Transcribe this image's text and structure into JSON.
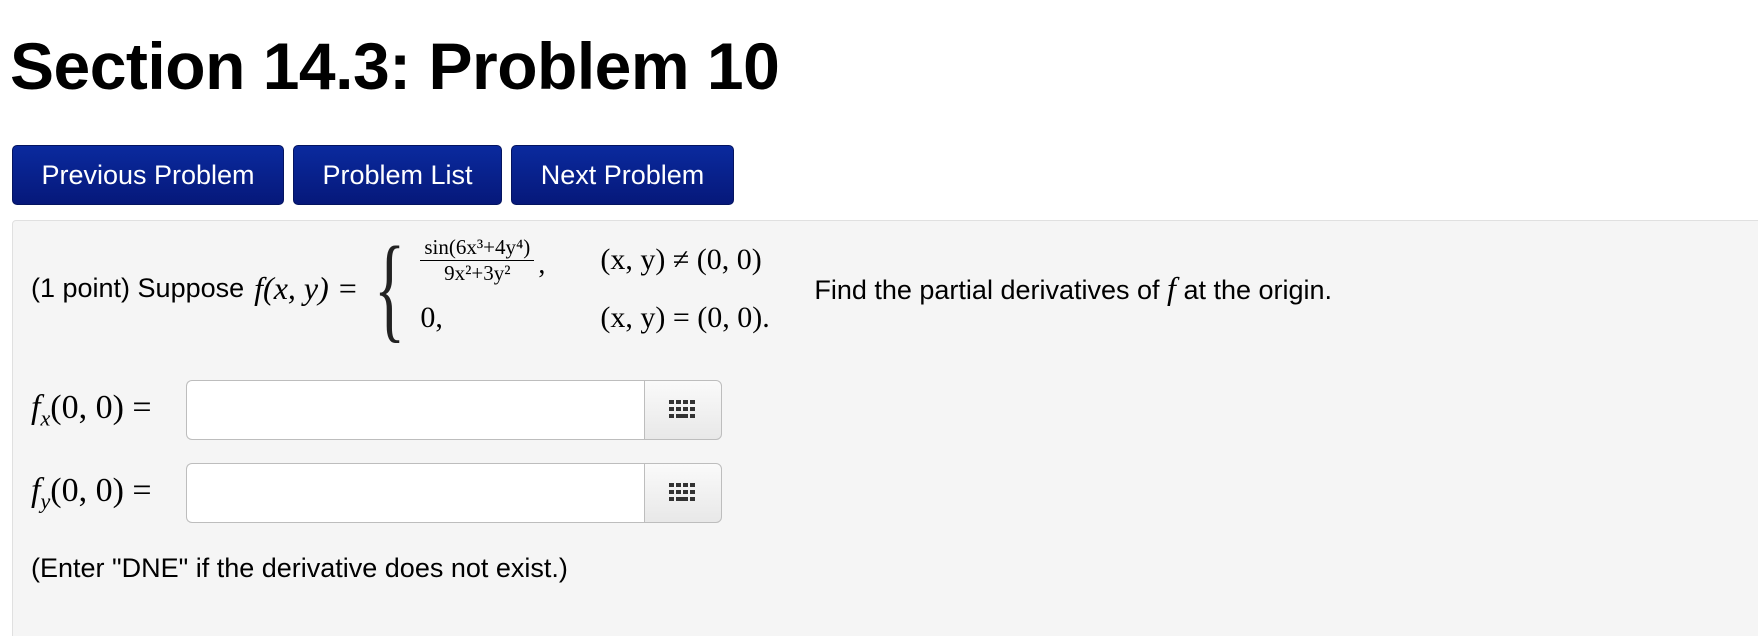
{
  "page": {
    "title": "Section 14.3: Problem 10"
  },
  "nav": {
    "previous": "Previous Problem",
    "list": "Problem List",
    "next": "Next Problem",
    "button_color": "#0a1f8f"
  },
  "problem": {
    "prefix": "(1 point) Suppose",
    "function_name": "f(x, y) =",
    "case1": {
      "numerator": "sin(6x³+4y⁴)",
      "denominator": "9x²+3y²",
      "condition": "(x, y) ≠ (0, 0)"
    },
    "case2": {
      "value": "0,",
      "condition": "(x, y) = (0, 0)."
    },
    "after_text_1": "Find the partial derivatives of",
    "after_f": "f",
    "after_text_2": "at the origin."
  },
  "answers": [
    {
      "label_main": "f",
      "label_sub": "x",
      "label_tail": "(0, 0) =",
      "value": "",
      "keypad_icon": "keypad-icon"
    },
    {
      "label_main": "f",
      "label_sub": "y",
      "label_tail": "(0, 0) =",
      "value": "",
      "keypad_icon": "keypad-icon"
    }
  ],
  "note": "(Enter \"DNE\" if the derivative does not exist.)",
  "colors": {
    "panel_bg": "#f5f5f5",
    "button_bg": "#0a1f8f"
  }
}
